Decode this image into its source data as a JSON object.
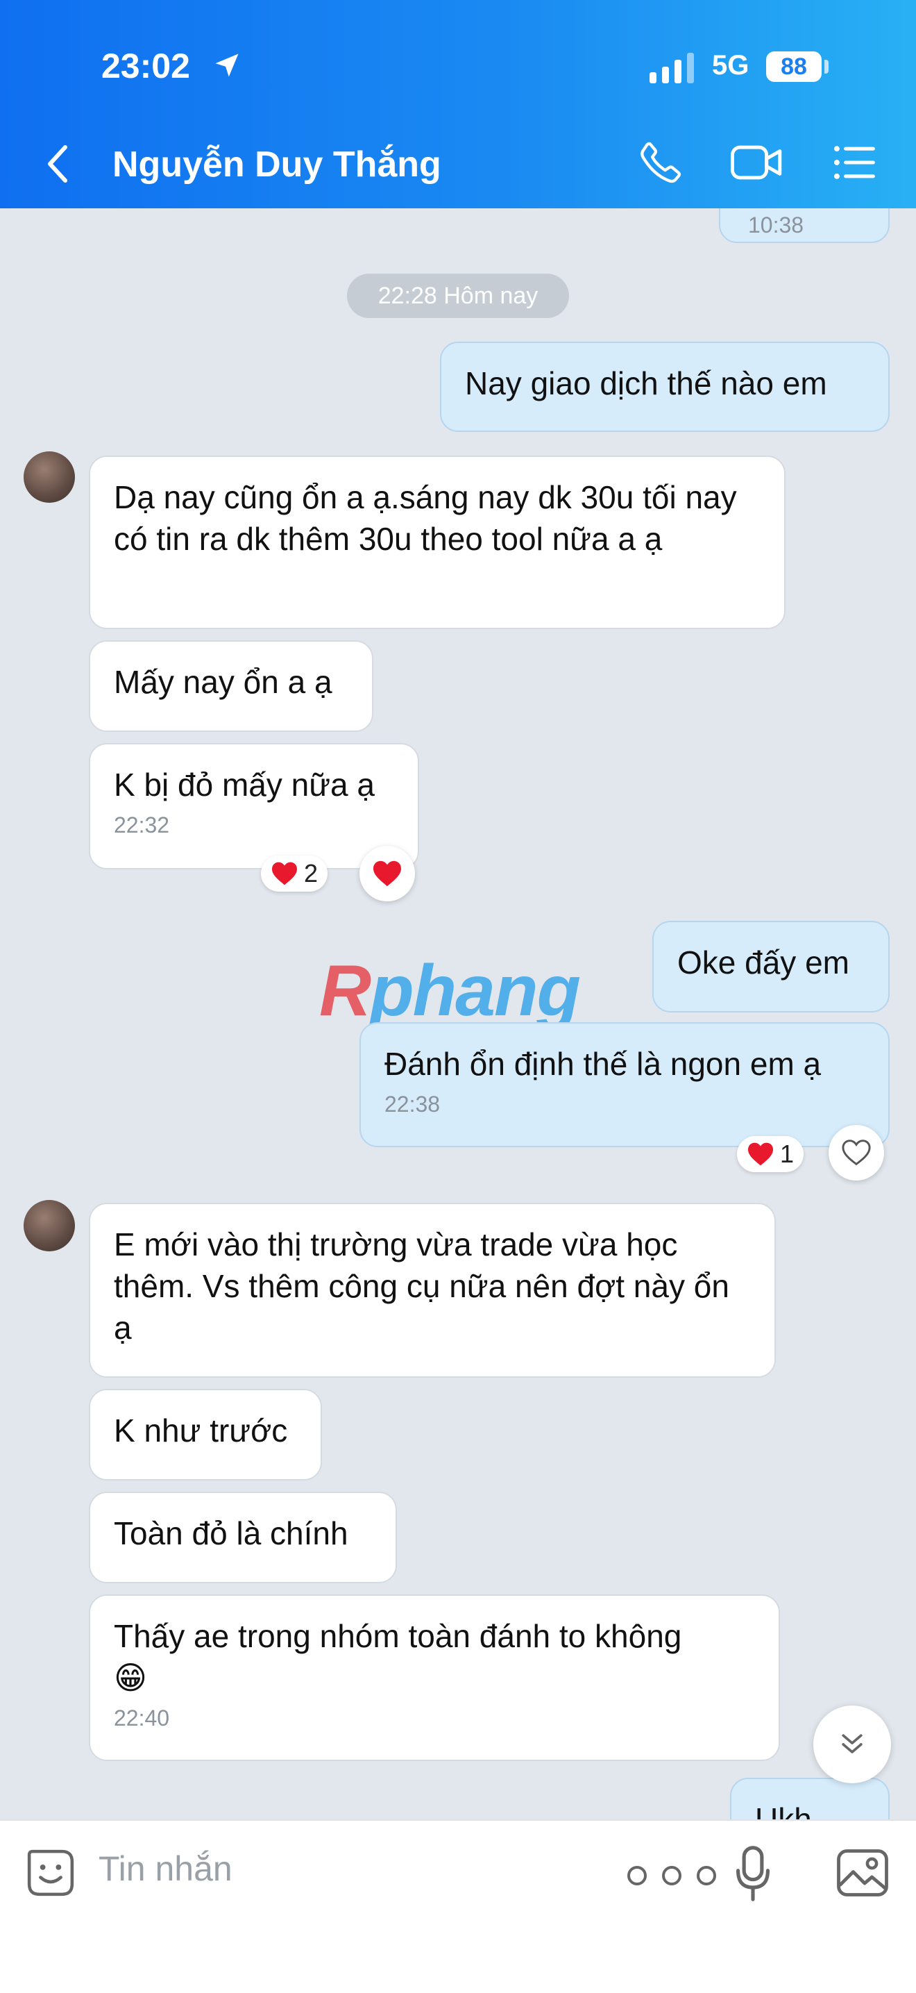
{
  "status_bar": {
    "time": "23:02",
    "network": "5G",
    "battery": "88"
  },
  "header": {
    "contact_name": "Nguyễn Duy Thắng"
  },
  "chat": {
    "prev_time": "10:38",
    "date_separator": "22:28 Hôm nay",
    "messages": [
      {
        "text": "Nay giao dịch thế nào em"
      },
      {
        "text": "Dạ nay cũng ổn a ạ.sáng nay dk 30u tối nay có tin ra dk thêm 30u theo tool nữa a ạ"
      },
      {
        "text": "Mấy nay ổn a ạ"
      },
      {
        "text": "K bị đỏ mấy nữa ạ",
        "time": "22:32",
        "reaction_count": "2"
      },
      {
        "text": "Oke đấy em"
      },
      {
        "text": "Đánh ổn định thế là ngon em ạ",
        "time": "22:38",
        "reaction_count": "1"
      },
      {
        "text": "E mới vào thị trường vừa trade vừa học thêm. Vs thêm công cụ nữa nên đợt này ổn ạ"
      },
      {
        "text": "K như trước"
      },
      {
        "text": "Toàn đỏ là chính"
      },
      {
        "text": "Thấy ae trong nhóm toàn đánh to không",
        "emoji": "😁",
        "time": "22:40"
      },
      {
        "text": "Ukh"
      }
    ]
  },
  "watermark": {
    "first": "R",
    "rest": "phang"
  },
  "composer": {
    "placeholder": "Tin nhắn"
  },
  "colors": {
    "header_start": "#0f6ff0",
    "header_end": "#28b0f4",
    "out_bubble": "#d6ecfb",
    "in_bubble": "#ffffff",
    "background": "#e2e7ee"
  }
}
